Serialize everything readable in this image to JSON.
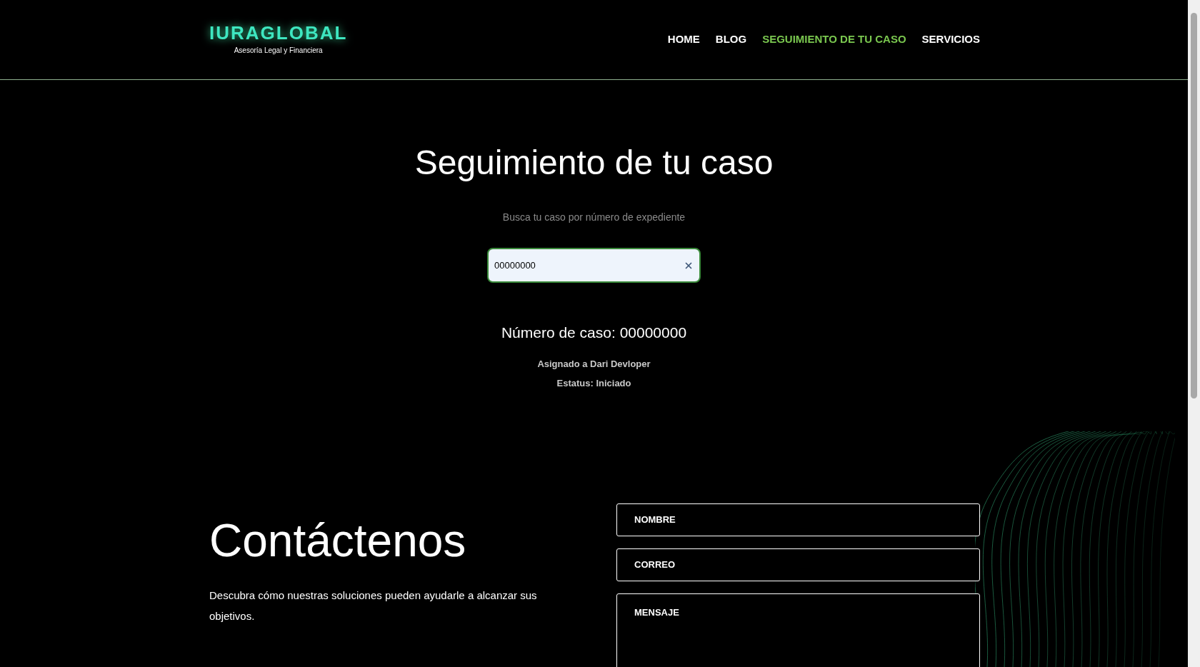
{
  "header": {
    "logo": {
      "name": "IURAGLOBAL",
      "tagline": "Asesoría Legal y Financiera"
    },
    "nav": [
      {
        "label": "HOME",
        "selected": false
      },
      {
        "label": "BLOG",
        "selected": false
      },
      {
        "label": "SEGUIMIENTO DE TU CASO",
        "selected": true
      },
      {
        "label": "SERVICIOS",
        "selected": false
      }
    ]
  },
  "tracking": {
    "title": "Seguimiento de tu caso",
    "subtitle": "Busca tu caso por número de expediente",
    "search": {
      "value": "00000000"
    },
    "result": {
      "case_number": "Número de caso: 00000000",
      "assigned": "Asignado a Dari Devloper",
      "status": "Estatus: Iniciado"
    }
  },
  "contact": {
    "title": "Contáctenos",
    "description": "Descubra cómo nuestras soluciones pueden ayudarle a alcanzar sus objetivos.",
    "fields": [
      {
        "kind": "line",
        "placeholder": "NOMBRE"
      },
      {
        "kind": "line",
        "placeholder": "CORREO"
      },
      {
        "kind": "area",
        "placeholder": "MENSAJE"
      }
    ]
  }
}
